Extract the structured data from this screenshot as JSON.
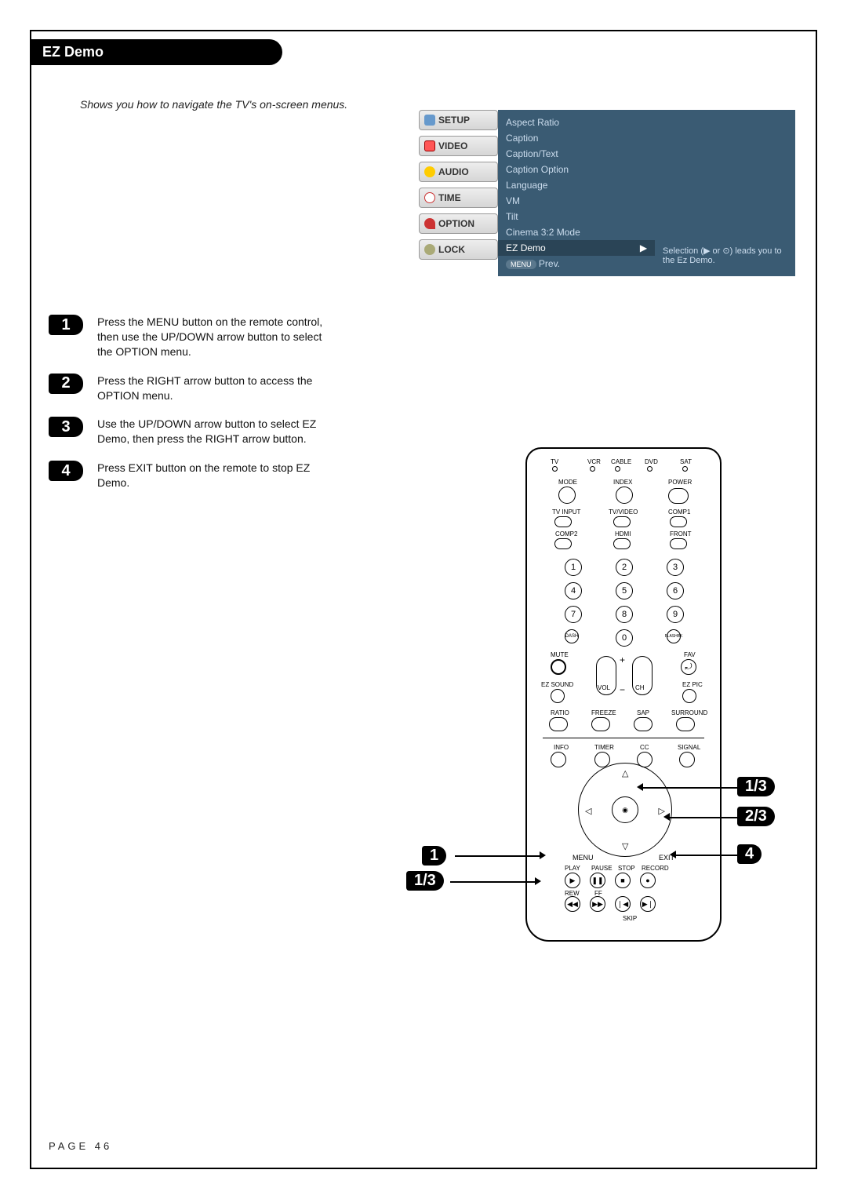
{
  "title": "EZ Demo",
  "intro": "Shows you how to navigate the TV's on-screen menus.",
  "menu": {
    "tabs": [
      "SETUP",
      "VIDEO",
      "AUDIO",
      "TIME",
      "OPTION",
      "LOCK"
    ],
    "items": [
      "Aspect Ratio",
      "Caption",
      "Caption/Text",
      "Caption Option",
      "Language",
      "VM",
      "Tilt",
      "Cinema 3:2 Mode",
      "EZ Demo"
    ],
    "highlight": "EZ Demo",
    "prev": "Prev.",
    "hint": "Selection (▶ or ⊙) leads you to the Ez Demo."
  },
  "steps": [
    {
      "n": "1",
      "text": "Press the MENU button on the remote control, then use the UP/DOWN arrow button to select the OPTION menu."
    },
    {
      "n": "2",
      "text": "Press the RIGHT arrow button to access the OPTION menu."
    },
    {
      "n": "3",
      "text": "Use the UP/DOWN arrow button to select EZ Demo, then press the RIGHT arrow button."
    },
    {
      "n": "4",
      "text": "Press EXIT button on the remote to stop EZ Demo."
    }
  ],
  "remote": {
    "top_leds": [
      "TV",
      "VCR",
      "CABLE",
      "DVD",
      "SAT"
    ],
    "row2": [
      "MODE",
      "INDEX",
      "POWER"
    ],
    "row3": [
      "TV INPUT",
      "TV/VIDEO",
      "COMP1"
    ],
    "row4": [
      "COMP2",
      "HDMI",
      "FRONT"
    ],
    "digits": [
      "1",
      "2",
      "3",
      "4",
      "5",
      "6",
      "7",
      "8",
      "9",
      "DASH",
      "0",
      "FLASHBK"
    ],
    "mid": {
      "mute": "MUTE",
      "fav": "FAV",
      "ezsound": "EZ SOUND",
      "ezpic": "EZ PIC",
      "vol": "VOL",
      "ch": "CH"
    },
    "row_func": [
      "RATIO",
      "FREEZE",
      "SAP",
      "SURROUND"
    ],
    "row_info": [
      "INFO",
      "TIMER",
      "CC",
      "SIGNAL"
    ],
    "nav": {
      "menu": "MENU",
      "exit": "EXIT",
      "ok": "◉"
    },
    "transport": {
      "r1": [
        "PLAY",
        "PAUSE",
        "STOP",
        "RECORD"
      ],
      "r2": [
        "REW",
        "FF",
        "",
        ""
      ],
      "skip": "SKIP"
    }
  },
  "annotations": {
    "a1": "1",
    "a2": "1/3",
    "a3": "1/3",
    "a4": "2/3",
    "a5": "4"
  },
  "page": "PAGE 46"
}
